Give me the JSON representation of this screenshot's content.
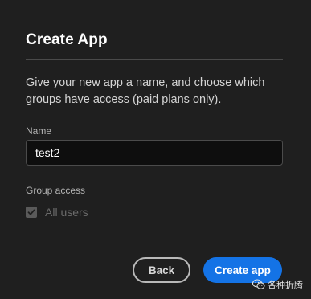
{
  "dialog": {
    "title": "Create App",
    "description": "Give your new app a name, and choose which groups have access (paid plans only).",
    "name_field": {
      "label": "Name",
      "value": "test2"
    },
    "group_access": {
      "label": "Group access",
      "options": [
        {
          "label": "All users",
          "checked": true,
          "disabled": true
        }
      ]
    },
    "buttons": {
      "back_label": "Back",
      "create_label": "Create app"
    }
  },
  "watermark": {
    "text": "各种折腾",
    "icon": "wechat-icon"
  },
  "colors": {
    "background": "#1f1f1f",
    "primary_button": "#1473e6",
    "input_background": "#0e0e0e"
  }
}
